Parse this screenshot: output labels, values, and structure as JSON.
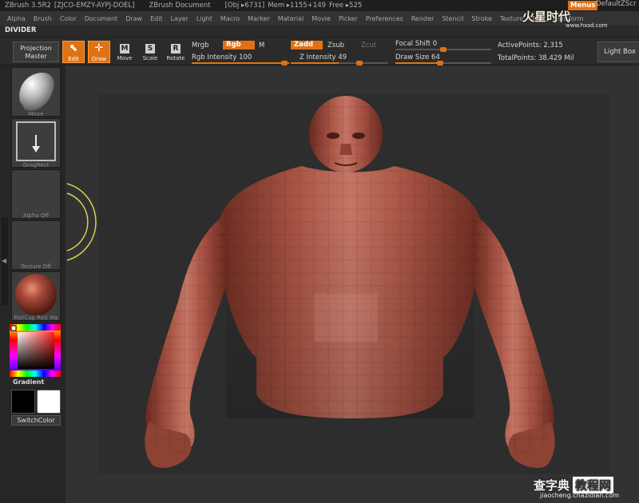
{
  "titlebar": {
    "app": "ZBrush 3.5R2",
    "license": "[ZJCO-EMZY-AYPJ-DOEL]",
    "document": "ZBrush Document",
    "obj": "[Obj ▸6731]",
    "mem": "Mem ▸1155+149",
    "free": "Free ▸525",
    "menus_btn": "Menus",
    "script": "DefaultZScr"
  },
  "menubar": [
    "Alpha",
    "Brush",
    "Color",
    "Document",
    "Draw",
    "Edit",
    "Layer",
    "Light",
    "Macro",
    "Marker",
    "Material",
    "Movie",
    "Picker",
    "Preferences",
    "Render",
    "Stencil",
    "Stroke",
    "Texture",
    "Tool",
    "Transform"
  ],
  "divider_label": "DIVIDER",
  "toolbar": {
    "projection_master": "Projection Master",
    "edit": "Edit",
    "draw": "Draw",
    "move": "Move",
    "scale": "Scale",
    "rotate": "Rotate",
    "mrgb": "Mrgb",
    "rgb": "Rgb",
    "m": "M",
    "rgb_intensity": "Rgb Intensity 100",
    "rgb_intensity_value": 100,
    "zadd": "Zadd",
    "zsub": "Zsub",
    "zcut": "Zcut",
    "z_intensity": "Z Intensity 49",
    "z_intensity_value": 49,
    "focal_shift": "Focal Shift 0",
    "focal_shift_value": 0,
    "draw_size": "Draw Size 64",
    "draw_size_value": 64,
    "active_points": "ActivePoints: 2,315",
    "total_points": "TotalPoints: 38.429 Mil",
    "light_box": "Light Box"
  },
  "tray": {
    "brush_label": "Move",
    "stroke_label": "DragRect",
    "alpha_label": "Alpha Off",
    "texture_label": "Texture Off",
    "material_label": "MatCap Red Wa",
    "gradient_label": "Gradient",
    "switch_color": "SwitchColor"
  },
  "watermark": {
    "top_text": "火星时代",
    "top_url": "www.hxsd.com",
    "bottom_text": "查字典",
    "bottom_box": "教程网",
    "bottom_url": "jiaocheng.chazidian.com"
  },
  "colors": {
    "accent": "#e07214",
    "model": "#9c4a3c",
    "canvas": "#2d2d2d"
  }
}
